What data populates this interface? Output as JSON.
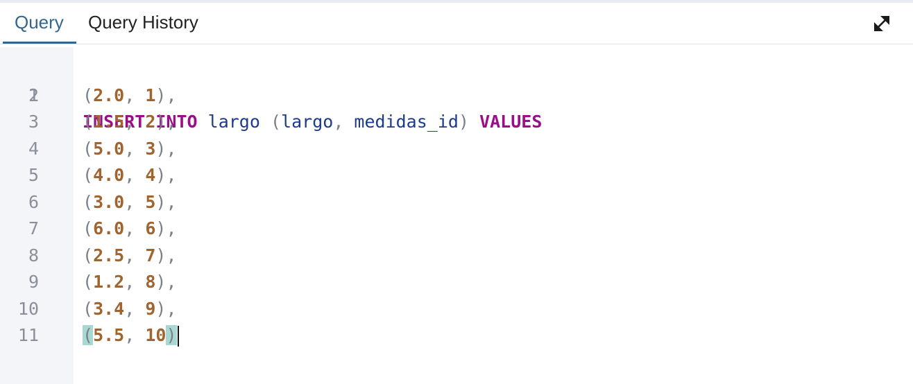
{
  "tabs": {
    "query": "Query",
    "history": "Query History"
  },
  "toolbar": {
    "expand_icon": "expand-diagonal-icon"
  },
  "editor": {
    "line_numbers": [
      "1",
      "2",
      "3",
      "4",
      "5",
      "6",
      "7",
      "8",
      "9",
      "10",
      "11"
    ],
    "lines": [
      "INSERT INTO largo (largo, medidas_id) VALUES",
      "(2.0, 1),",
      "(1.5, 2),",
      "(5.0, 3),",
      "(4.0, 4),",
      "(3.0, 5),",
      "(6.0, 6),",
      "(2.5, 7),",
      "(1.2, 8),",
      "(3.4, 9),",
      "(5.5, 10)"
    ],
    "tokens": {
      "kw_insert": "INSERT",
      "kw_into": "INTO",
      "table": "largo",
      "col1": "largo",
      "col2": "medidas_id",
      "kw_values": "VALUES",
      "rows": [
        {
          "a": "2.0",
          "b": "1",
          "tail": "),"
        },
        {
          "a": "1.5",
          "b": "2",
          "tail": "),"
        },
        {
          "a": "5.0",
          "b": "3",
          "tail": "),"
        },
        {
          "a": "4.0",
          "b": "4",
          "tail": "),"
        },
        {
          "a": "3.0",
          "b": "5",
          "tail": "),"
        },
        {
          "a": "6.0",
          "b": "6",
          "tail": "),"
        },
        {
          "a": "2.5",
          "b": "7",
          "tail": "),"
        },
        {
          "a": "1.2",
          "b": "8",
          "tail": "),"
        },
        {
          "a": "3.4",
          "b": "9",
          "tail": "),"
        }
      ],
      "last_row": {
        "a": "5.5",
        "b": "10"
      }
    }
  },
  "colors": {
    "accent": "#326690",
    "keyword": "#990f8a",
    "number": "#a0642f",
    "identifier": "#1c3b8f",
    "bracket_match": "#a8d8d2",
    "gutter_bg": "#f3f5f9"
  }
}
